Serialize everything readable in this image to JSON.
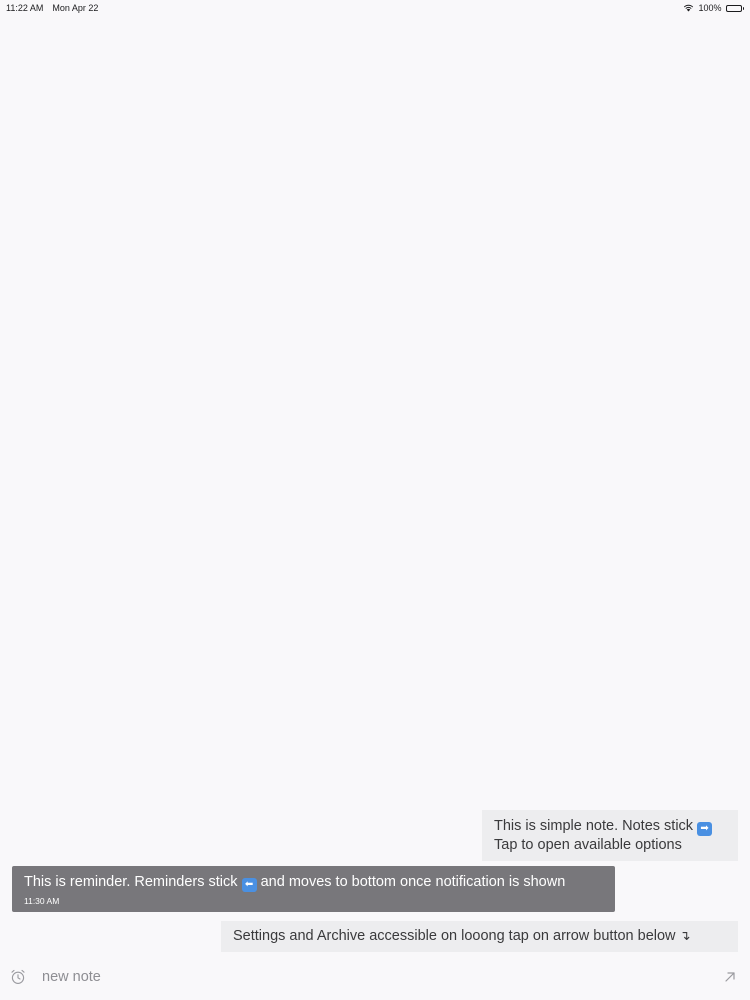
{
  "status_bar": {
    "time": "11:22 AM",
    "date": "Mon Apr 22",
    "battery": "100%"
  },
  "notes": {
    "simple": {
      "line1": "This is simple note. Notes stick",
      "line1_emoji": "➡",
      "line2": "Tap to open available options"
    },
    "reminder": {
      "text_before": "This is reminder. Reminders stick",
      "emoji": "⬅",
      "text_after": "and moves to bottom once notification is shown",
      "time": "11:30 AM"
    },
    "settings": {
      "text": "Settings and Archive accessible on looong tap on arrow button below",
      "arrow": "↴"
    }
  },
  "input_bar": {
    "placeholder": "new note"
  },
  "colors": {
    "background": "#f9f8fa",
    "note_bg": "#ededef",
    "reminder_bg": "#78777b",
    "emoji_blue": "#4a90e2"
  },
  "icons": {
    "wifi": "wifi-icon",
    "battery": "battery-icon",
    "alarm": "alarm-clock-icon",
    "send": "arrow-up-right-icon"
  }
}
